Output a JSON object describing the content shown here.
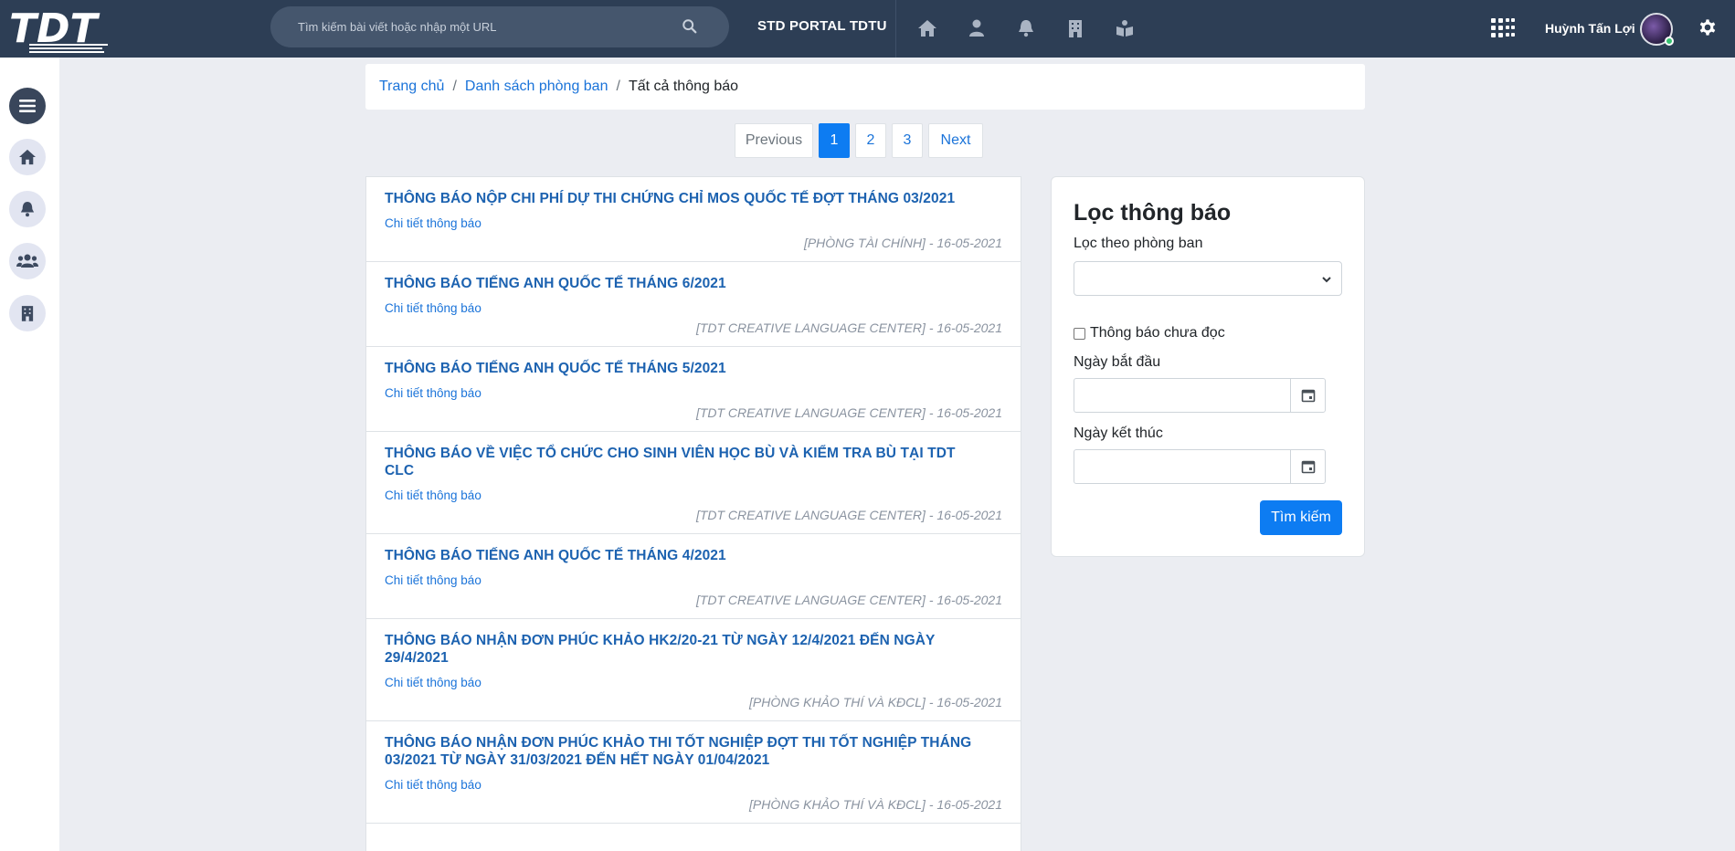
{
  "header": {
    "logo_text": "TDT",
    "search_placeholder": "Tìm kiếm bài viết hoặc nhập một URL",
    "portal_title": "STD PORTAL TDTU",
    "user_name": "Huỳnh Tấn Lợi",
    "nav_icons": [
      "home-icon",
      "user-icon",
      "bell-icon",
      "building-icon",
      "reader-icon"
    ]
  },
  "sidebar": {
    "icons": [
      "menu-icon",
      "home-icon",
      "bell-icon",
      "users-icon",
      "building-icon"
    ]
  },
  "breadcrumb": {
    "home": "Trang chủ",
    "departments": "Danh sách phòng ban",
    "current": "Tất cả thông báo",
    "separator": "/"
  },
  "pagination": {
    "previous": "Previous",
    "pages": [
      "1",
      "2",
      "3"
    ],
    "active": "1",
    "next": "Next"
  },
  "notifications": [
    {
      "title": "THÔNG BÁO NỘP CHI PHÍ DỰ THI CHỨNG CHỈ MOS QUỐC TẾ ĐỢT THÁNG 03/2021",
      "detail": "Chi tiết thông báo",
      "meta": "[PHÒNG TÀI CHÍNH] - 16-05-2021"
    },
    {
      "title": "THÔNG BÁO TIẾNG ANH QUỐC TẾ THÁNG 6/2021",
      "detail": "Chi tiết thông báo",
      "meta": "[TDT CREATIVE LANGUAGE CENTER] - 16-05-2021"
    },
    {
      "title": "THÔNG BÁO TIẾNG ANH QUỐC TẾ THÁNG 5/2021",
      "detail": "Chi tiết thông báo",
      "meta": "[TDT CREATIVE LANGUAGE CENTER] - 16-05-2021"
    },
    {
      "title": "THÔNG BÁO VỀ VIỆC TỔ CHỨC CHO SINH VIÊN HỌC BÙ VÀ KIỂM TRA BÙ TẠI TDT CLC",
      "detail": "Chi tiết thông báo",
      "meta": "[TDT CREATIVE LANGUAGE CENTER] - 16-05-2021"
    },
    {
      "title": "THÔNG BÁO TIẾNG ANH QUỐC TẾ THÁNG 4/2021",
      "detail": "Chi tiết thông báo",
      "meta": "[TDT CREATIVE LANGUAGE CENTER] - 16-05-2021"
    },
    {
      "title": "THÔNG BÁO NHẬN ĐƠN PHÚC KHẢO HK2/20-21 TỪ NGÀY 12/4/2021 ĐẾN NGÀY 29/4/2021",
      "detail": "Chi tiết thông báo",
      "meta": "[PHÒNG KHẢO THÍ VÀ KĐCL] - 16-05-2021"
    },
    {
      "title": "THÔNG BÁO NHẬN ĐƠN PHÚC KHẢO THI TỐT NGHIỆP ĐỢT THI TỐT NGHIỆP THÁNG 03/2021 TỪ NGÀY 31/03/2021 ĐẾN HẾT NGÀY 01/04/2021",
      "detail": "Chi tiết thông báo",
      "meta": "[PHÒNG KHẢO THÍ VÀ KĐCL] - 16-05-2021"
    }
  ],
  "filter": {
    "heading": "Lọc thông báo",
    "department_label": "Lọc theo phòng ban",
    "department_value": "",
    "unread_label": "Thông báo chưa đọc",
    "unread_checked": false,
    "start_label": "Ngày bắt đầu",
    "start_value": "",
    "end_label": "Ngày kết thúc",
    "end_value": "",
    "search_button": "Tìm kiếm"
  },
  "colors": {
    "topbar": "#2d3e55",
    "accent": "#0d7cf2",
    "title_link": "#1c62b0"
  }
}
